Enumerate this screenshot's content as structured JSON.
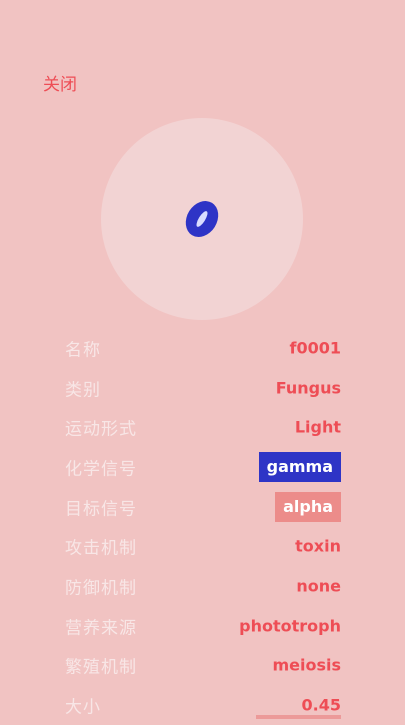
{
  "close_label": "关闭",
  "organism": {
    "body_color": "#2e34c6",
    "core_color": "#d9dcff",
    "view_color": "#f2d3d3"
  },
  "attributes": [
    {
      "label": "名称",
      "value": "f0001"
    },
    {
      "label": "类别",
      "value": "Fungus"
    },
    {
      "label": "运动形式",
      "value": "Light"
    },
    {
      "label": "化学信号",
      "value": "gamma",
      "chip_color": "#2e34c6"
    },
    {
      "label": "目标信号",
      "value": "alpha",
      "chip_color": "#ec8c8a"
    },
    {
      "label": "攻击机制",
      "value": "toxin"
    },
    {
      "label": "防御机制",
      "value": "none"
    },
    {
      "label": "营养来源",
      "value": "phototroph"
    },
    {
      "label": "繁殖机制",
      "value": "meiosis"
    },
    {
      "label": "大小",
      "value": "0.45"
    }
  ],
  "colors": {
    "background": "#f1c3c2",
    "accent": "#ee4d55",
    "label": "#f8e6e6"
  }
}
